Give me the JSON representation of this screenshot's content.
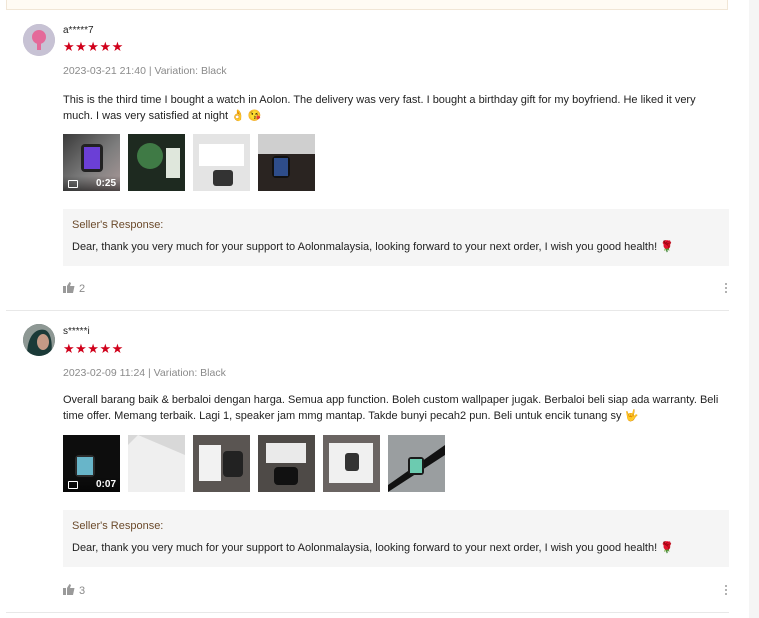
{
  "reviews": [
    {
      "username": "a*****7",
      "stars": "★★★★★",
      "meta": "2023-03-21 21:40 | Variation: Black",
      "content": "This is the third time I bought a watch in Aolon. The delivery was very fast. I bought a birthday gift for my boyfriend. He liked it very much. I was very satisfied at night 👌 😘",
      "video_duration": "0:25",
      "seller_title": "Seller's Response:",
      "seller_text": "Dear, thank you very much for your support to Aolonmalaysia, looking forward to your next order, I wish you good health! 🌹",
      "likes": "2"
    },
    {
      "username": "s*****i",
      "stars": "★★★★★",
      "meta": "2023-02-09 11:24 | Variation: Black",
      "content": "Overall barang baik & berbaloi dengan harga. Semua app function. Boleh custom wallpaper jugak. Berbaloi beli siap ada warranty. Beli time offer. Memang terbaik. Lagi 1, speaker jam mmg mantap. Takde bunyi pecah2 pun. Beli untuk encik tunang sy 🤟",
      "video_duration": "0:07",
      "seller_title": "Seller's Response:",
      "seller_text": "Dear, thank you very much for your support to Aolonmalaysia, looking forward to your next order, I wish you good health! 🌹",
      "likes": "3"
    }
  ],
  "colors": {
    "star": "#d0011b",
    "seller_title": "#6b4a2b",
    "meta": "#8a8a8a"
  },
  "icons": [
    "thumbs-up-icon",
    "more-vertical-icon",
    "video-camera-icon"
  ]
}
